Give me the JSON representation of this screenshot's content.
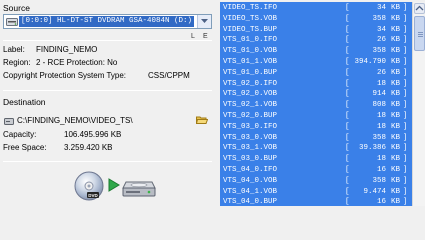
{
  "source": {
    "title": "Source",
    "drive": "[0:0:0] HL-DT-ST DVDRAM GSA-4084N (D:)",
    "flag_l": "L",
    "flag_e": "E"
  },
  "disc": {
    "label_caption": "Label:",
    "label_value": "FINDING_NEMO",
    "region_caption": "Region:",
    "region_value": "2  -  RCE Protection:  No",
    "copy_caption": "Copyright Protection System Type:",
    "copy_value": "CSS/CPPM"
  },
  "destination": {
    "title": "Destination",
    "path": "C:\\FINDING_NEMO\\VIDEO_TS\\",
    "capacity_caption": "Capacity:",
    "capacity_value": "106.495.996 KB",
    "free_caption": "Free Space:",
    "free_value": "3.259.420 KB"
  },
  "files": [
    {
      "name": "VIDEO_TS.IFO",
      "size": "34",
      "unit": "KB"
    },
    {
      "name": "VIDEO_TS.VOB",
      "size": "358",
      "unit": "KB"
    },
    {
      "name": "VIDEO_TS.BUP",
      "size": "34",
      "unit": "KB"
    },
    {
      "name": "VTS_01_0.IFO",
      "size": "26",
      "unit": "KB"
    },
    {
      "name": "VTS_01_0.VOB",
      "size": "358",
      "unit": "KB"
    },
    {
      "name": "VTS_01_1.VOB",
      "size": "394.790",
      "unit": "KB"
    },
    {
      "name": "VTS_01_0.BUP",
      "size": "26",
      "unit": "KB"
    },
    {
      "name": "VTS_02_0.IFO",
      "size": "18",
      "unit": "KB"
    },
    {
      "name": "VTS_02_0.VOB",
      "size": "914",
      "unit": "KB"
    },
    {
      "name": "VTS_02_1.VOB",
      "size": "808",
      "unit": "KB"
    },
    {
      "name": "VTS_02_0.BUP",
      "size": "18",
      "unit": "KB"
    },
    {
      "name": "VTS_03_0.IFO",
      "size": "18",
      "unit": "KB"
    },
    {
      "name": "VTS_03_0.VOB",
      "size": "358",
      "unit": "KB"
    },
    {
      "name": "VTS_03_1.VOB",
      "size": "39.386",
      "unit": "KB"
    },
    {
      "name": "VTS_03_0.BUP",
      "size": "18",
      "unit": "KB"
    },
    {
      "name": "VTS_04_0.IFO",
      "size": "16",
      "unit": "KB"
    },
    {
      "name": "VTS_04_0.VOB",
      "size": "358",
      "unit": "KB"
    },
    {
      "name": "VTS_04_1.VOB",
      "size": "9.474",
      "unit": "KB"
    },
    {
      "name": "VTS_04_0.BUP",
      "size": "16",
      "unit": "KB"
    }
  ],
  "colors": {
    "list_background": "#3a80e8",
    "selection": "#316ac5"
  },
  "icons": [
    "dvd-drive-icon",
    "hard-disk-icon",
    "folder-open-icon",
    "dvd-disc-icon",
    "play-arrow-icon",
    "hard-drive-icon"
  ]
}
